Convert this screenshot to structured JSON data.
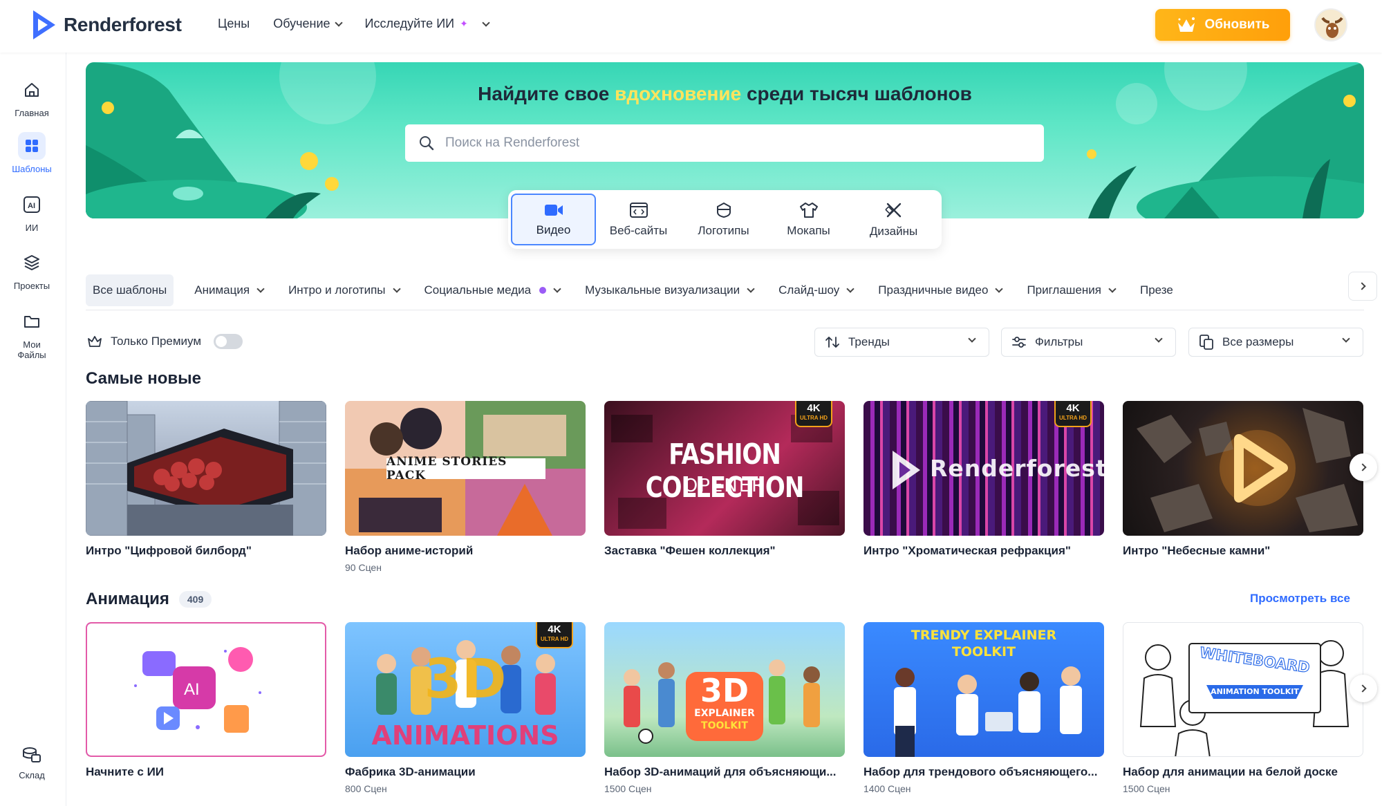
{
  "brand": {
    "name": "Renderforest",
    "accent": "#2f6bff",
    "upgrade_color": "#ffaa14"
  },
  "topnav": {
    "pricing": "Цены",
    "learning": "Обучение",
    "explore_ai": "Исследуйте ИИ",
    "upgrade": "Обновить"
  },
  "sidebar": {
    "home": "Главная",
    "templates": "Шаблоны",
    "ai": "ИИ",
    "projects": "Проекты",
    "myfiles_1": "Мои",
    "myfiles_2": "Файлы",
    "stock": "Склад"
  },
  "hero": {
    "title_before": "Найдите свое ",
    "title_highlight": "вдохновение",
    "title_after": " среди тысяч шаблонов",
    "search_placeholder": "Поиск на Renderforest"
  },
  "category_tabs": [
    {
      "label": "Видео",
      "icon": "video-icon",
      "active": true
    },
    {
      "label": "Веб-сайты",
      "icon": "code-icon"
    },
    {
      "label": "Логотипы",
      "icon": "logo-icon"
    },
    {
      "label": "Мокапы",
      "icon": "tshirt-icon"
    },
    {
      "label": "Дизайны",
      "icon": "design-icon"
    }
  ],
  "filters": {
    "chips": [
      "Все шаблоны",
      "Анимация",
      "Интро и логотипы",
      "Социальные медиа",
      "Музыкальные визуализации",
      "Слайд-шоу",
      "Праздничные видео",
      "Приглашения",
      "Презе"
    ],
    "premium_only": "Только Премиум",
    "sort": "Тренды",
    "filters": "Фильтры",
    "sizes": "Все размеры"
  },
  "newest": {
    "title": "Самые новые",
    "items": [
      {
        "title": "Интро \"Цифровой билборд\"",
        "sub": ""
      },
      {
        "title": "Набор аниме-историй",
        "sub": "90 Сцен",
        "overlay": "ANIME STORIES PACK"
      },
      {
        "title": "Заставка \"Фешен коллекция\"",
        "sub": "",
        "overlay1": "FASHION COLLECTION",
        "overlay2": "OPENER"
      },
      {
        "title": "Интро \"Хроматическая рефракция\"",
        "sub": "",
        "overlay": "Renderforest"
      },
      {
        "title": "Интро \"Небесные камни\"",
        "sub": ""
      }
    ]
  },
  "animation": {
    "title": "Анимация",
    "count": "409",
    "view_all": "Просмотреть все",
    "items": [
      {
        "title": "Начните с ИИ",
        "sub": ""
      },
      {
        "title": "Фабрика 3D-анимации",
        "sub": "800 Сцен",
        "overlay1": "3D",
        "overlay2": "ANIMATIONS"
      },
      {
        "title": "Набор 3D-анимаций для объясняющи...",
        "sub": "1500 Сцен",
        "overlay1": "3D",
        "overlay2": "EXPLAINER",
        "overlay3": "TOOLKIT"
      },
      {
        "title": "Набор для трендового объясняющего...",
        "sub": "1400 Сцен",
        "overlay1": "TRENDY EXPLAINER",
        "overlay2": "TOOLKIT"
      },
      {
        "title": "Набор для анимации на белой доске",
        "sub": "1500 Сцен",
        "overlay1": "WHITEBOARD",
        "overlay2": "ANIMATION TOOLKIT"
      }
    ]
  },
  "badge_4k": {
    "main": "4K",
    "sub": "ULTRA HD"
  }
}
